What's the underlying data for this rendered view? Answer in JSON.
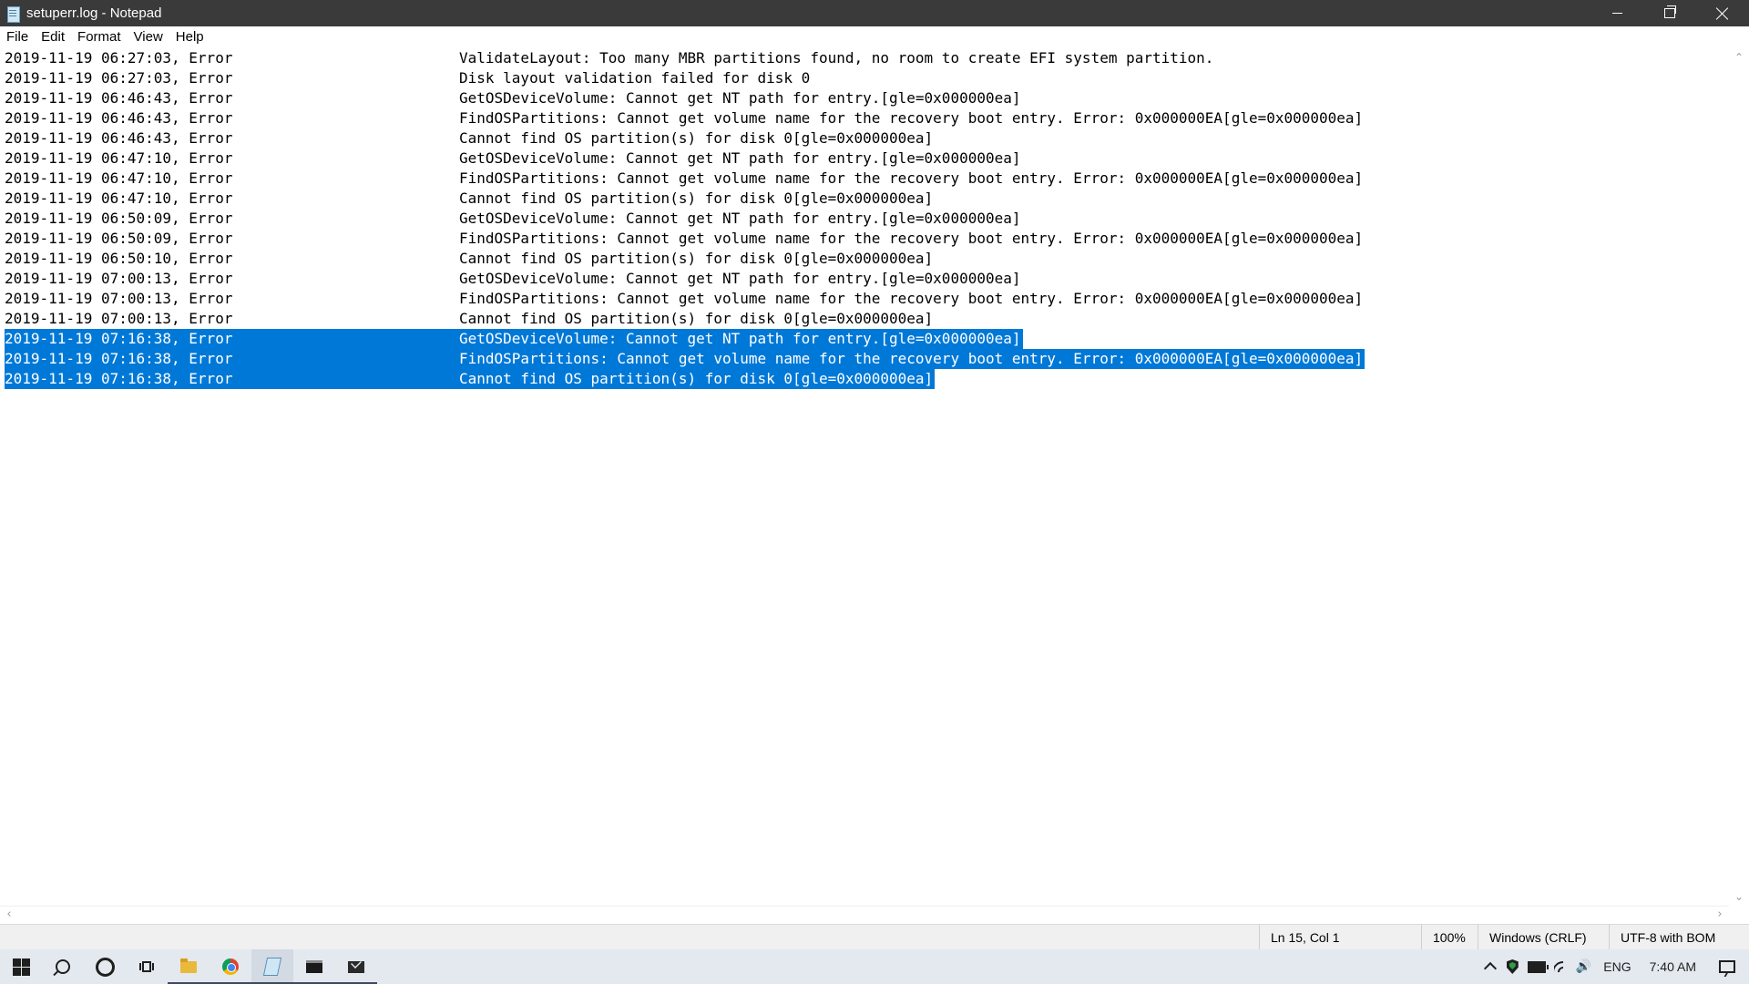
{
  "window": {
    "title": "setuperr.log - Notepad"
  },
  "menu": {
    "file": "File",
    "edit": "Edit",
    "format": "Format",
    "view": "View",
    "help": "Help"
  },
  "log_lines": [
    {
      "ts": "2019-11-19 06:27:03, Error",
      "msg": "ValidateLayout: Too many MBR partitions found, no room to create EFI system partition."
    },
    {
      "ts": "2019-11-19 06:27:03, Error",
      "msg": "Disk layout validation failed for disk 0"
    },
    {
      "ts": "2019-11-19 06:46:43, Error",
      "msg": "GetOSDeviceVolume: Cannot get NT path for entry.[gle=0x000000ea]"
    },
    {
      "ts": "2019-11-19 06:46:43, Error",
      "msg": "FindOSPartitions: Cannot get volume name for the recovery boot entry. Error: 0x000000EA[gle=0x000000ea]"
    },
    {
      "ts": "2019-11-19 06:46:43, Error",
      "msg": "Cannot find OS partition(s) for disk 0[gle=0x000000ea]"
    },
    {
      "ts": "2019-11-19 06:47:10, Error",
      "msg": "GetOSDeviceVolume: Cannot get NT path for entry.[gle=0x000000ea]"
    },
    {
      "ts": "2019-11-19 06:47:10, Error",
      "msg": "FindOSPartitions: Cannot get volume name for the recovery boot entry. Error: 0x000000EA[gle=0x000000ea]"
    },
    {
      "ts": "2019-11-19 06:47:10, Error",
      "msg": "Cannot find OS partition(s) for disk 0[gle=0x000000ea]"
    },
    {
      "ts": "2019-11-19 06:50:09, Error",
      "msg": "GetOSDeviceVolume: Cannot get NT path for entry.[gle=0x000000ea]"
    },
    {
      "ts": "2019-11-19 06:50:09, Error",
      "msg": "FindOSPartitions: Cannot get volume name for the recovery boot entry. Error: 0x000000EA[gle=0x000000ea]"
    },
    {
      "ts": "2019-11-19 06:50:10, Error",
      "msg": "Cannot find OS partition(s) for disk 0[gle=0x000000ea]"
    },
    {
      "ts": "2019-11-19 07:00:13, Error",
      "msg": "GetOSDeviceVolume: Cannot get NT path for entry.[gle=0x000000ea]"
    },
    {
      "ts": "2019-11-19 07:00:13, Error",
      "msg": "FindOSPartitions: Cannot get volume name for the recovery boot entry. Error: 0x000000EA[gle=0x000000ea]"
    },
    {
      "ts": "2019-11-19 07:00:13, Error",
      "msg": "Cannot find OS partition(s) for disk 0[gle=0x000000ea]"
    },
    {
      "ts": "2019-11-19 07:16:38, Error",
      "msg": "GetOSDeviceVolume: Cannot get NT path for entry.[gle=0x000000ea]",
      "selected": true
    },
    {
      "ts": "2019-11-19 07:16:38, Error",
      "msg": "FindOSPartitions: Cannot get volume name for the recovery boot entry. Error: 0x000000EA[gle=0x000000ea]",
      "selected": true
    },
    {
      "ts": "2019-11-19 07:16:38, Error",
      "msg": "Cannot find OS partition(s) for disk 0[gle=0x000000ea]",
      "selected": true
    }
  ],
  "status": {
    "position": "Ln 15, Col 1",
    "zoom": "100%",
    "line_ending": "Windows (CRLF)",
    "encoding": "UTF-8 with BOM"
  },
  "taskbar": {
    "language": "ENG",
    "clock": "7:40 AM"
  },
  "colors": {
    "titlebar": "#3a3a3a",
    "selection": "#0078d7",
    "taskbar": "#e4e9ef",
    "statusbar": "#f0f0f0"
  },
  "icons": {
    "app": "notepad-icon",
    "start": "windows-start-icon",
    "search": "search-icon",
    "cortana": "cortana-icon",
    "task_view": "task-view-icon",
    "explorer": "file-explorer-icon",
    "chrome": "chrome-icon",
    "notepad": "notepad-icon",
    "terminal": "command-prompt-icon",
    "mail": "mail-icon",
    "tray_chevron": "chevron-up-icon",
    "defender": "shield-icon",
    "battery": "battery-icon",
    "network": "wifi-icon",
    "volume": "speaker-icon",
    "notifications": "notification-icon"
  }
}
